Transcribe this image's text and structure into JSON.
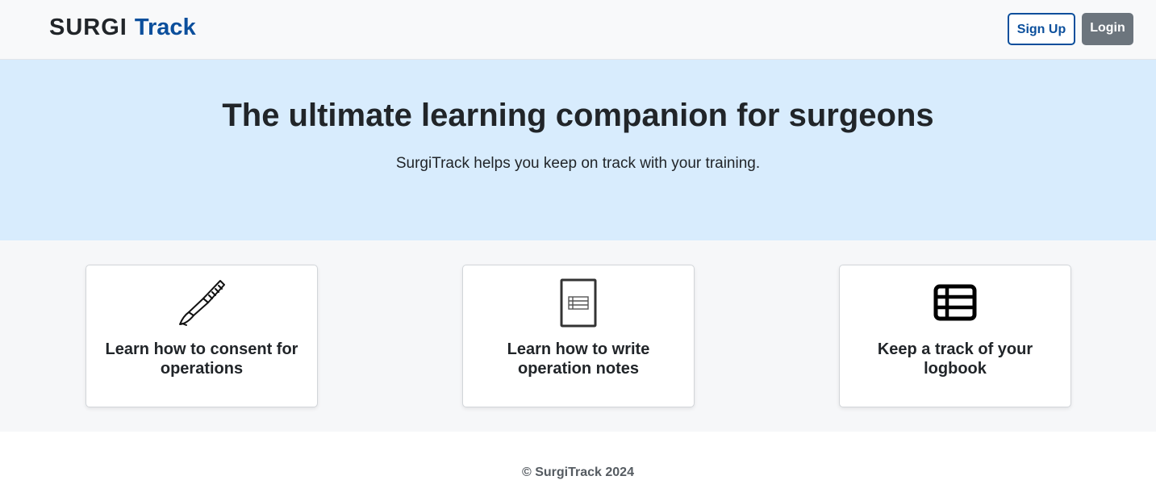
{
  "brand": {
    "part1": "SURGI",
    "part2": "Track"
  },
  "nav": {
    "signup_label": "Sign Up",
    "login_label": "Login"
  },
  "hero": {
    "title": "The ultimate learning companion for surgeons",
    "subtitle": "SurgiTrack helps you keep on track with your training."
  },
  "features": [
    {
      "icon": "scalpel-icon",
      "label": "Learn how to consent for operations"
    },
    {
      "icon": "document-icon",
      "label": "Learn how to write operation notes"
    },
    {
      "icon": "table-list-icon",
      "label": "Keep a track of your logbook"
    }
  ],
  "footer": {
    "copyright": "© SurgiTrack 2024"
  },
  "colors": {
    "brand_blue": "#0b4f9c",
    "hero_bg": "#d8ecfd",
    "login_gray": "#6c757d"
  }
}
